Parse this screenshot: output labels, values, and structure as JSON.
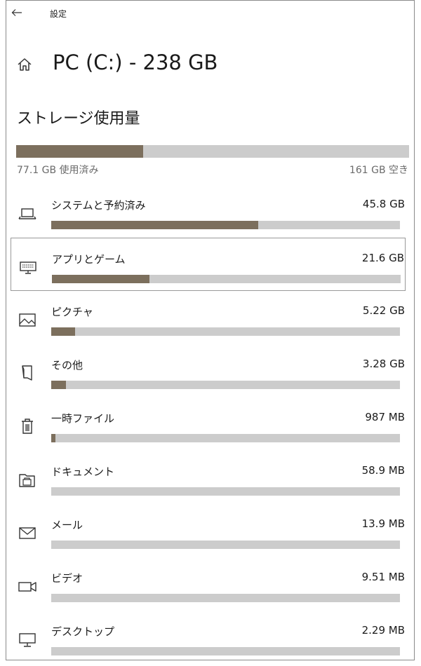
{
  "window": {
    "app_title": "設定"
  },
  "header": {
    "title": "PC (C:) - 238 GB"
  },
  "storage": {
    "section_title": "ストレージ使用量",
    "used_label": "77.1 GB 使用済み",
    "free_label": "161 GB 空き",
    "used_fraction": 0.324
  },
  "categories": [
    {
      "label": "システムと予約済み",
      "size": "45.8 GB",
      "fraction": 0.593,
      "icon": "laptop-icon"
    },
    {
      "label": "アプリとゲーム",
      "size": "21.6 GB",
      "fraction": 0.28,
      "icon": "keyboard-icon"
    },
    {
      "label": "ピクチャ",
      "size": "5.22 GB",
      "fraction": 0.068,
      "icon": "picture-icon"
    },
    {
      "label": "その他",
      "size": "3.28 GB",
      "fraction": 0.042,
      "icon": "folded-page-icon"
    },
    {
      "label": "一時ファイル",
      "size": "987 MB",
      "fraction": 0.012,
      "icon": "trash-icon"
    },
    {
      "label": "ドキュメント",
      "size": "58.9 MB",
      "fraction": 0.0,
      "icon": "documents-folder-icon"
    },
    {
      "label": "メール",
      "size": "13.9 MB",
      "fraction": 0.0,
      "icon": "mail-icon"
    },
    {
      "label": "ビデオ",
      "size": "9.51 MB",
      "fraction": 0.0,
      "icon": "video-camera-icon"
    },
    {
      "label": "デスクトップ",
      "size": "2.29 MB",
      "fraction": 0.0,
      "icon": "desktop-icon"
    }
  ],
  "colors": {
    "bar_fill": "#7c6f5d",
    "bar_track": "#cccccc",
    "selection_border": "#999999"
  }
}
